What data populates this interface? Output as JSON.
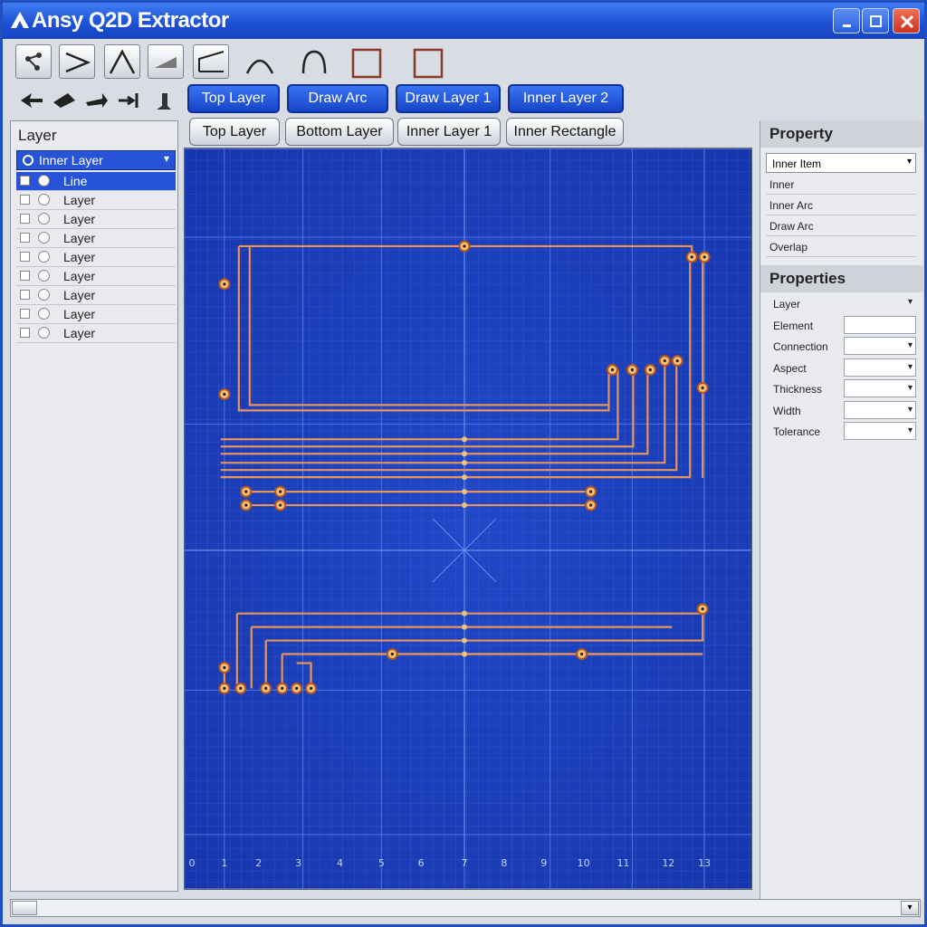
{
  "app": {
    "title": "Ansy Q2D Extractor"
  },
  "window_controls": [
    "minimize-icon",
    "maximize-icon",
    "close-icon"
  ],
  "tools": [
    "select-tool",
    "line-tool",
    "polyline-tool",
    "arc-tool",
    "angle-tool",
    "corner-tool",
    "curve-tool",
    "arch-tool",
    "rectangle-tool",
    "rectangle-tool-2"
  ],
  "nav_buttons": [
    "arrow-left-icon",
    "arrow-diag-icon",
    "arrow-right-icon",
    "arrow-end-icon",
    "arrow-up-icon"
  ],
  "action_buttons": [
    "Top Layer",
    "Draw Arc",
    "Draw Layer 1",
    "Inner Layer 2"
  ],
  "view_tabs": [
    "Top Layer",
    "Bottom Layer",
    "Inner Layer 1",
    "Inner Rectangle"
  ],
  "sidebar": {
    "header": "Layer",
    "combo_value": "Inner Layer",
    "rows": [
      {
        "label": "Line",
        "selected": true
      },
      {
        "label": "Layer",
        "selected": false
      },
      {
        "label": "Layer",
        "selected": false
      },
      {
        "label": "Layer",
        "selected": false
      },
      {
        "label": "Layer",
        "selected": false
      },
      {
        "label": "Layer",
        "selected": false
      },
      {
        "label": "Layer",
        "selected": false
      },
      {
        "label": "Layer",
        "selected": false
      },
      {
        "label": "Layer",
        "selected": false
      }
    ]
  },
  "property_panel": {
    "header": "Property",
    "combo_value": "Inner Item",
    "items": [
      "Inner",
      "Inner Arc",
      "Draw Arc",
      "Overlap"
    ]
  },
  "properties_panel": {
    "header": "Properties",
    "rows": [
      {
        "label": "Layer",
        "value": ""
      },
      {
        "label": "Element",
        "value": ""
      },
      {
        "label": "Connection",
        "value": ""
      },
      {
        "label": "Aspect",
        "value": ""
      },
      {
        "label": "Thickness",
        "value": ""
      },
      {
        "label": "Width",
        "value": ""
      },
      {
        "label": "Tolerance",
        "value": ""
      }
    ]
  },
  "colors": {
    "canvas_bg": "#1a3fbe",
    "trace": "#e8935a",
    "accent": "#2753d8",
    "title_bar": "#1b4fd4"
  },
  "chart_data": {
    "type": "diagram",
    "x_ticks": [
      "0",
      "1",
      "2",
      "3",
      "4",
      "5",
      "6",
      "7",
      "8",
      "9",
      "10",
      "11",
      "12",
      "13"
    ]
  }
}
